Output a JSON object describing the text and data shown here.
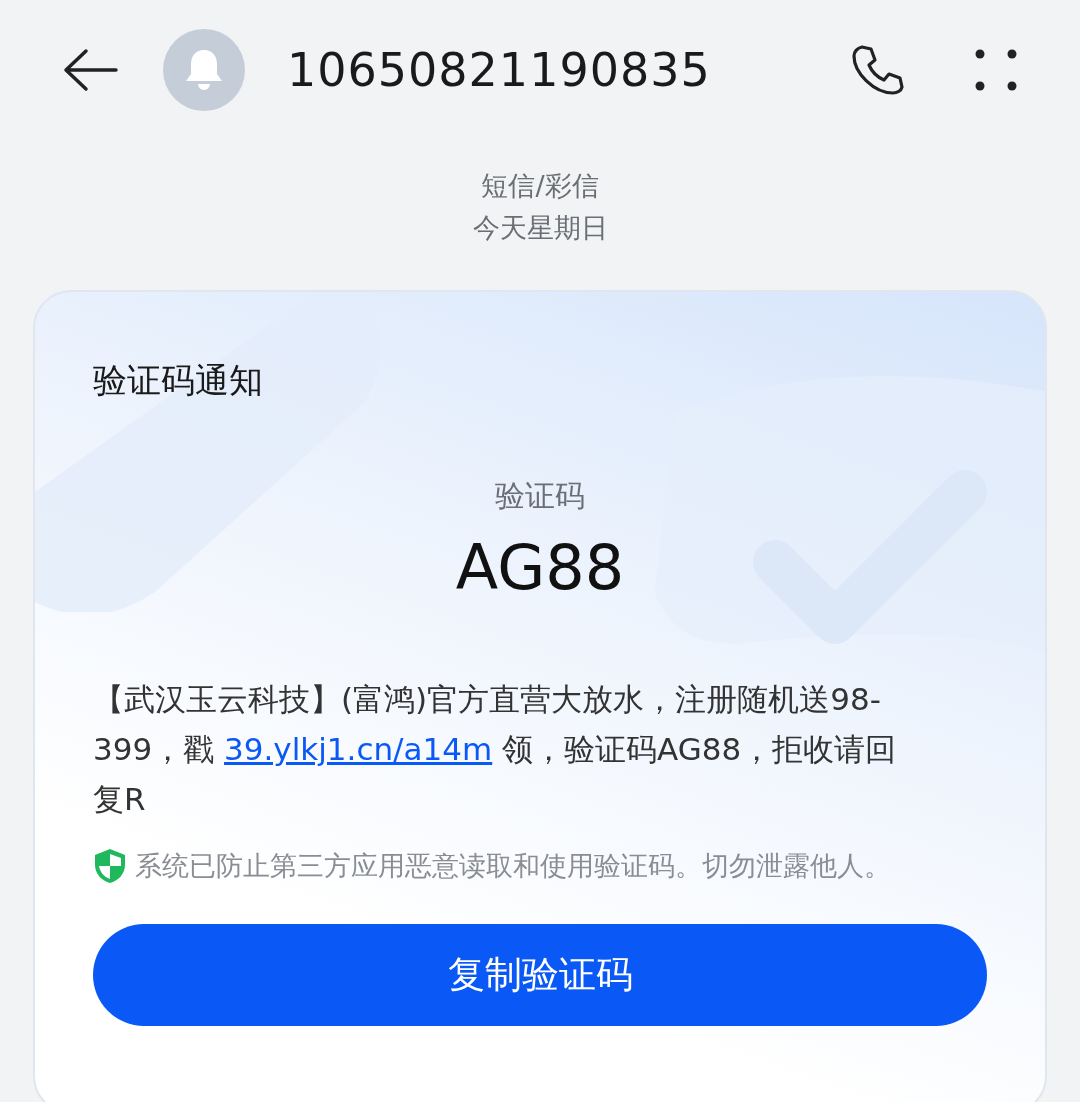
{
  "header": {
    "title": "10650821190835"
  },
  "conversation": {
    "channel": "短信/彩信",
    "date": "今天星期日"
  },
  "card": {
    "title": "验证码通知",
    "code_label": "验证码",
    "code": "AG88",
    "message": {
      "before": "【武汉玉云科技】(富鸿)官方直营大放水，注册随机送98-399，戳 ",
      "link": "39.ylkj1.cn/a14m",
      "after": " 领，验证码AG88，拒收请回复R"
    },
    "notice": "系统已防止第三方应用恶意读取和使用验证码。切勿泄露他人。",
    "button": "复制验证码"
  }
}
